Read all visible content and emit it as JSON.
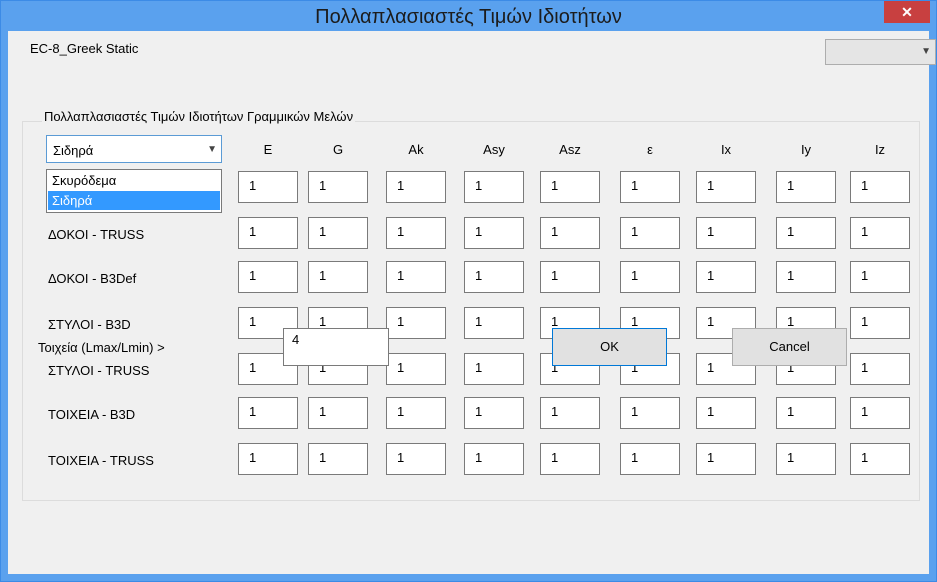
{
  "window": {
    "title": "Πολλαπλασιαστές Τιμών Ιδιοτήτων",
    "close_glyph": "✕"
  },
  "project": {
    "name": "EC-8_Greek Static",
    "selector_value": ""
  },
  "group": {
    "title": "Πολλαπλασιαστές Τιμών Ιδιοτήτων Γραμμικών Μελών"
  },
  "material": {
    "selected": "Σιδηρά",
    "options": [
      "Σκυρόδεμα",
      "Σιδηρά"
    ],
    "highlighted_index": 1
  },
  "columns": [
    "E",
    "G",
    "Ak",
    "Asy",
    "Asz",
    "ε",
    "Ix",
    "Iy",
    "Iz"
  ],
  "rows": [
    {
      "label": "",
      "values": [
        "1",
        "1",
        "1",
        "1",
        "1",
        "1",
        "1",
        "1",
        "1"
      ]
    },
    {
      "label": "ΔΟΚΟΙ - TRUSS",
      "values": [
        "1",
        "1",
        "1",
        "1",
        "1",
        "1",
        "1",
        "1",
        "1"
      ]
    },
    {
      "label": "ΔΟΚΟΙ - B3Def",
      "values": [
        "1",
        "1",
        "1",
        "1",
        "1",
        "1",
        "1",
        "1",
        "1"
      ]
    },
    {
      "label": "ΣΤΥΛΟΙ - B3D",
      "values": [
        "1",
        "1",
        "1",
        "1",
        "1",
        "1",
        "1",
        "1",
        "1"
      ]
    },
    {
      "label": "ΣΤΥΛΟΙ - TRUSS",
      "values": [
        "1",
        "1",
        "1",
        "1",
        "1",
        "1",
        "1",
        "1",
        "1"
      ]
    },
    {
      "label": "ΤΟΙΧΕΙΑ - B3D",
      "values": [
        "1",
        "1",
        "1",
        "1",
        "1",
        "1",
        "1",
        "1",
        "1"
      ]
    },
    {
      "label": "ΤΟΙΧΕΙΑ - TRUSS",
      "values": [
        "1",
        "1",
        "1",
        "1",
        "1",
        "1",
        "1",
        "1",
        "1"
      ]
    }
  ],
  "walls": {
    "label": "Τοιχεία (Lmax/Lmin) >",
    "value": "4"
  },
  "buttons": {
    "ok": "OK",
    "cancel": "Cancel"
  },
  "colors": {
    "titlebar": "#5aa1ee",
    "close": "#c84040",
    "selection": "#3399ff"
  }
}
